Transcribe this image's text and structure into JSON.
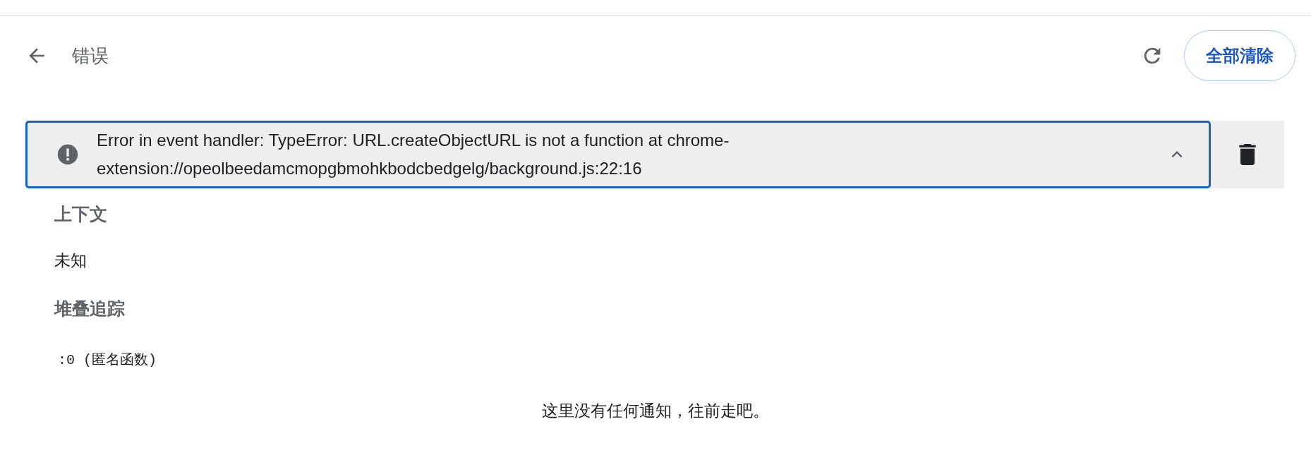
{
  "header": {
    "title": "错误",
    "clear_button": "全部清除"
  },
  "error": {
    "message": "Error in event handler: TypeError: URL.createObjectURL is not a function at chrome-extension://opeolbeedamcmopgbmohkbodcbedgelg/background.js:22:16",
    "expanded": true,
    "selected": true
  },
  "details": {
    "context_heading": "上下文",
    "context_value": "未知",
    "stack_heading": "堆叠追踪",
    "stack_frames": [
      ":0 (匿名函数)"
    ]
  },
  "empty_message": "这里没有任何通知，往前走吧。"
}
